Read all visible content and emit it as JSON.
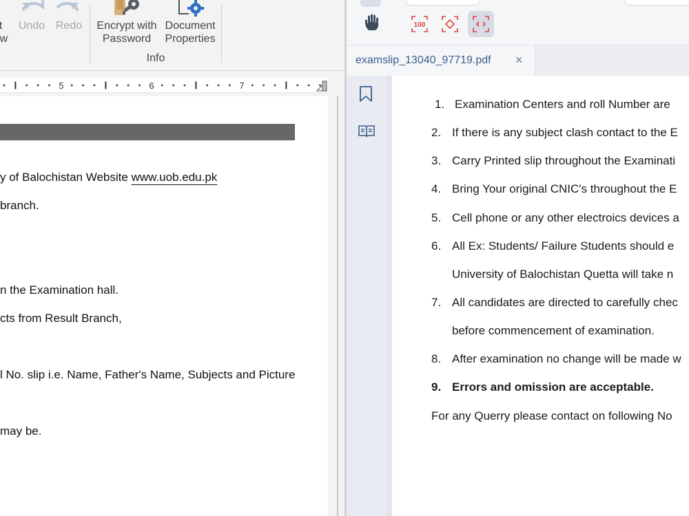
{
  "word": {
    "ribbon": {
      "partial_label_1": "t",
      "partial_label_2": "ew",
      "undo_label": "Undo",
      "redo_label": "Redo",
      "encrypt_label_1": "Encrypt with",
      "encrypt_label_2": "Password",
      "doc_props_label_1": "Document",
      "doc_props_label_2": "Properties",
      "group_label": "Info"
    },
    "ruler": {
      "numbers": [
        "5",
        "6",
        "7"
      ]
    },
    "document": {
      "lines": [
        "y of Balochistan Website ",
        "branch.",
        "n the Examination hall.",
        "cts from Result Branch,",
        "l No. slip i.e. Name, Father's Name, Subjects and Picture",
        "may be."
      ],
      "link": "www.uob.edu.pk"
    }
  },
  "pdf": {
    "tab_title": "examslip_13040_97719.pdf",
    "tab_close": "×",
    "zoom_100_label": "100",
    "items": [
      {
        "num": "1.",
        "text": "Examination Centers and roll Number are"
      },
      {
        "num": "2.",
        "text": "If there is any subject clash contact to the E"
      },
      {
        "num": "3.",
        "text": "Carry Printed slip throughout the Examinati"
      },
      {
        "num": "4.",
        "text": "Bring Your original CNIC's throughout the E"
      },
      {
        "num": "5.",
        "text": "Cell phone or any other electroics devices a"
      },
      {
        "num": "6.",
        "text": "All Ex: Students/ Failure Students should e"
      },
      {
        "num": "",
        "text": "University of Balochistan Quetta will take n"
      },
      {
        "num": "7.",
        "text": "All candidates are directed to carefully chec"
      },
      {
        "num": "",
        "text": "before commencement of examination."
      },
      {
        "num": "8.",
        "text": "After examination no change will be made w"
      },
      {
        "num": "9.",
        "text": "Errors and omission are acceptable."
      }
    ],
    "footer": "For any Querry please contact on following No"
  },
  "colors": {
    "accent": "#3b5d8c",
    "zoom_icon": "#e0413a",
    "doc_bar": "#676767"
  }
}
